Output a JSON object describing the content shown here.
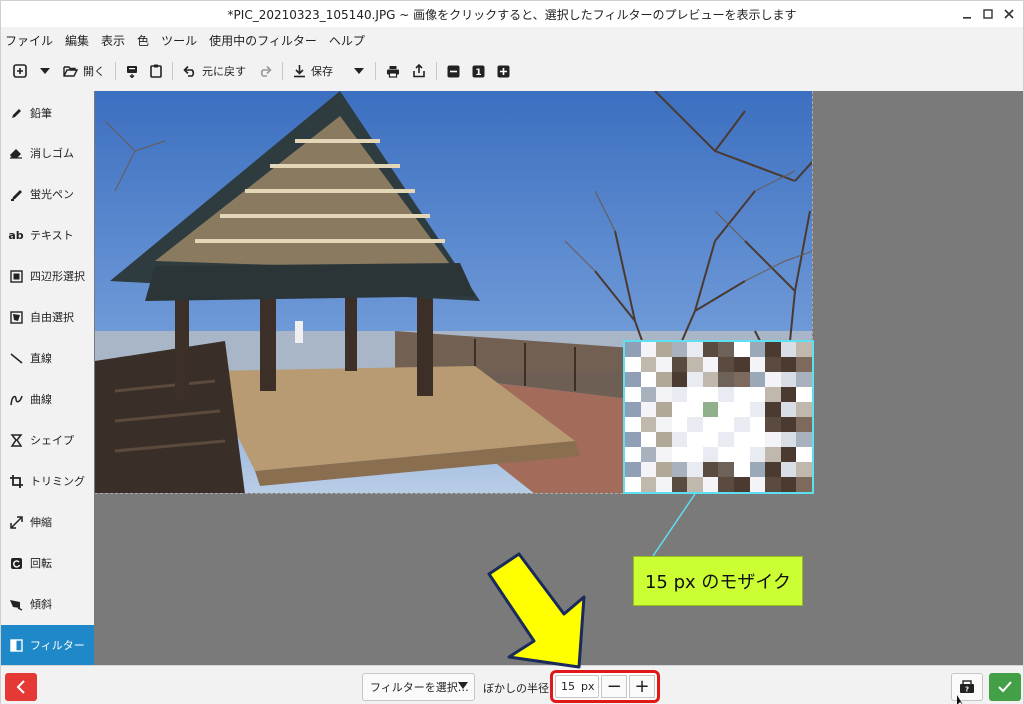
{
  "window": {
    "title": "*PIC_20210323_105140.JPG ~ 画像をクリックすると、選択したフィルターのプレビューを表示します",
    "minimize": "‒",
    "maximize": "□",
    "close": "✕"
  },
  "menu": [
    "ファイル",
    "編集",
    "表示",
    "色",
    "ツール",
    "使用中のフィルター",
    "ヘルプ"
  ],
  "toolbar": {
    "open_label": "開く",
    "undo_label": "元に戻す",
    "save_label": "保存",
    "zoom_reset": "1"
  },
  "sidebar": {
    "items": [
      {
        "label": "鉛筆",
        "icon": "pencil-icon"
      },
      {
        "label": "消しゴム",
        "icon": "eraser-icon"
      },
      {
        "label": "蛍光ペン",
        "icon": "highlighter-icon"
      },
      {
        "label": "テキスト",
        "icon": "text-icon",
        "glyph": "ab"
      },
      {
        "label": "四辺形選択",
        "icon": "rect-select-icon"
      },
      {
        "label": "自由選択",
        "icon": "free-select-icon"
      },
      {
        "label": "直線",
        "icon": "line-icon"
      },
      {
        "label": "曲線",
        "icon": "curve-icon"
      },
      {
        "label": "シェイプ",
        "icon": "shape-icon"
      },
      {
        "label": "トリミング",
        "icon": "crop-icon"
      },
      {
        "label": "伸縮",
        "icon": "scale-icon"
      },
      {
        "label": "回転",
        "icon": "rotate-icon"
      },
      {
        "label": "傾斜",
        "icon": "skew-icon"
      },
      {
        "label": "フィルター",
        "icon": "filter-icon",
        "active": true
      }
    ]
  },
  "annotation": {
    "callout_text": "15 px のモザイク"
  },
  "bottom": {
    "filter_select": "フィルターを選択…",
    "radius_label": "ぼかしの半径",
    "radius_value": "15",
    "radius_unit": "px",
    "minus": "−",
    "plus": "+"
  },
  "colors": {
    "accent": "#1e88c8",
    "danger": "#e53935",
    "success": "#43a047",
    "highlight": "#ccff33",
    "mosaic_border": "#5ee0f0"
  }
}
